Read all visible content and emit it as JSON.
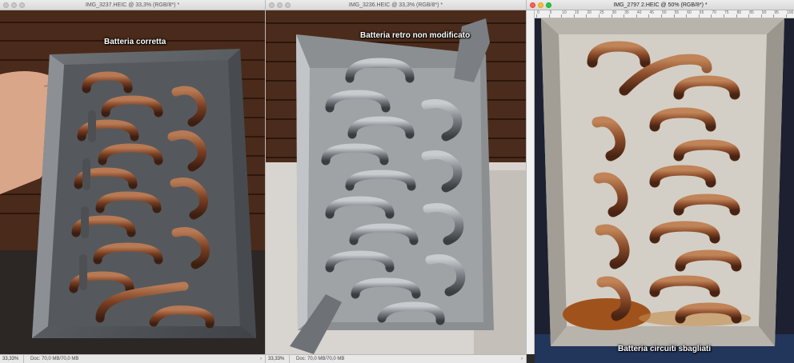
{
  "windows": [
    {
      "title": "IMG_3237.HEIC @ 33,3% (RGB/8*) *",
      "caption": "Batteria corretta",
      "status_zoom": "33,33%",
      "status_doc": "Doc: 70,0 MB/70,0 MB"
    },
    {
      "title": "IMG_3236.HEIC @ 33,3% (RGB/8*) *",
      "caption": "Batteria retro non modificato",
      "status_zoom": "33,33%",
      "status_doc": "Doc: 70,0 MB/70,0 MB"
    },
    {
      "title": "IMG_2797 2.HEIC @ 50% (RGB/8*) *",
      "caption": "Batteria circuiti sbagliati",
      "ruler_ticks": [
        "0",
        "5",
        "10",
        "15",
        "20",
        "25",
        "30",
        "35",
        "40",
        "45",
        "50",
        "55",
        "60",
        "65",
        "70",
        "75",
        "80",
        "85",
        "90",
        "95",
        "100"
      ]
    }
  ],
  "colors": {
    "copper": "#8a4b2a",
    "steel": "#7d8185",
    "silver_tray": "#b8b4ac",
    "brick": "#5a3320",
    "rust": "#a0521c"
  },
  "icons": {
    "close": "close-icon",
    "minimize": "minimize-icon",
    "zoom": "zoom-icon"
  }
}
